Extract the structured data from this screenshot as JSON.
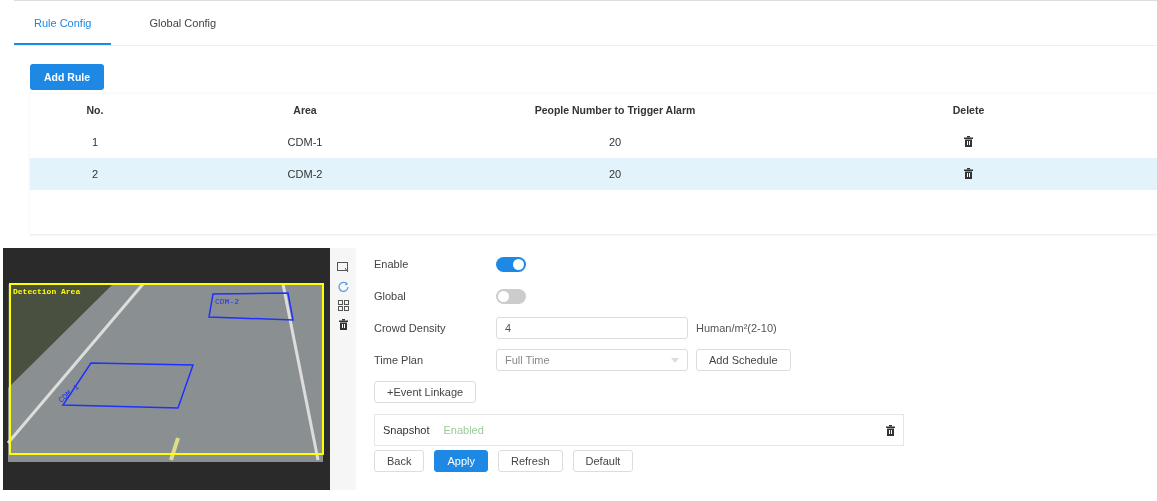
{
  "tabs": [
    {
      "label": "Rule Config",
      "selected": true
    },
    {
      "label": "Global Config",
      "selected": false
    }
  ],
  "add_rule_button": "Add Rule",
  "table": {
    "columns": [
      "No.",
      "Area",
      "People Number to Trigger Alarm",
      "Delete"
    ],
    "rows": [
      {
        "no": "1",
        "area": "CDM-1",
        "people": "20",
        "selected": false
      },
      {
        "no": "2",
        "area": "CDM-2",
        "people": "20",
        "selected": true
      }
    ]
  },
  "video": {
    "detection_label": "Detection Area",
    "areas": [
      "CDM-2",
      "CDM-1"
    ]
  },
  "form": {
    "enable": {
      "label": "Enable",
      "on": true
    },
    "global": {
      "label": "Global",
      "on": false
    },
    "crowd_density": {
      "label": "Crowd Density",
      "value": "4",
      "unit": "Human/m²(2-10)"
    },
    "time_plan": {
      "label": "Time Plan",
      "value": "Full Time",
      "button": "Add Schedule"
    },
    "event_linkage_button": "+Event Linkage",
    "snapshot": {
      "label": "Snapshot",
      "status": "Enabled"
    }
  },
  "buttons": [
    {
      "label": "Back",
      "kind": "default"
    },
    {
      "label": "Apply",
      "kind": "primary"
    },
    {
      "label": "Refresh",
      "kind": "default"
    },
    {
      "label": "Default",
      "kind": "default"
    }
  ]
}
